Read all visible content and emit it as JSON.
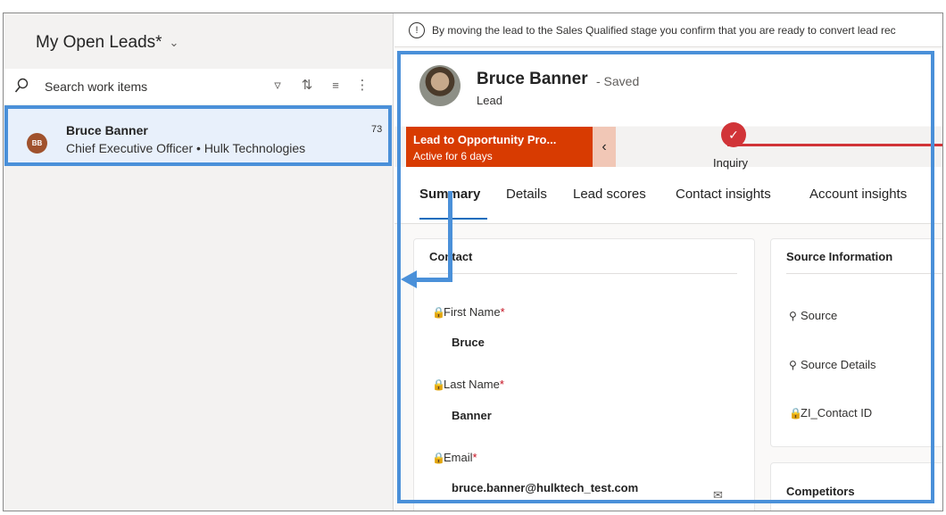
{
  "list_panel": {
    "view_title": "My Open Leads*",
    "search_placeholder": "Search work items",
    "items": [
      {
        "initials": "BB",
        "name": "Bruce Banner",
        "subtitle": "Chief Executive Officer • Hulk Technologies",
        "score": "73",
        "avatar_color": "#a0522d"
      }
    ]
  },
  "record": {
    "notice": "By moving the lead to the Sales Qualified stage you confirm that you are ready to convert lead rec",
    "name": "Bruce Banner",
    "save_status": "- Saved",
    "entity_type": "Lead",
    "process": {
      "title": "Lead to Opportunity Pro...",
      "duration": "Active for 6 days",
      "stage": "Inquiry",
      "color": "#d83b01"
    },
    "tabs": [
      "Summary",
      "Details",
      "Lead scores",
      "Contact insights",
      "Account insights"
    ],
    "contact_section": {
      "title": "Contact",
      "fields": [
        {
          "label": "First Name",
          "value": "Bruce"
        },
        {
          "label": "Last Name",
          "value": "Banner"
        },
        {
          "label": "Email",
          "value": "bruce.banner@hulktech_test.com"
        }
      ],
      "required_marker": "*"
    },
    "source_section": {
      "title": "Source Information",
      "fields": [
        "Source",
        "Source Details",
        "ZI_Contact ID"
      ]
    },
    "competitors_section": {
      "title": "Competitors"
    }
  },
  "colors": {
    "accent": "#0f6cbd",
    "annotation": "#4a90d9",
    "required": "#c50f1f"
  }
}
